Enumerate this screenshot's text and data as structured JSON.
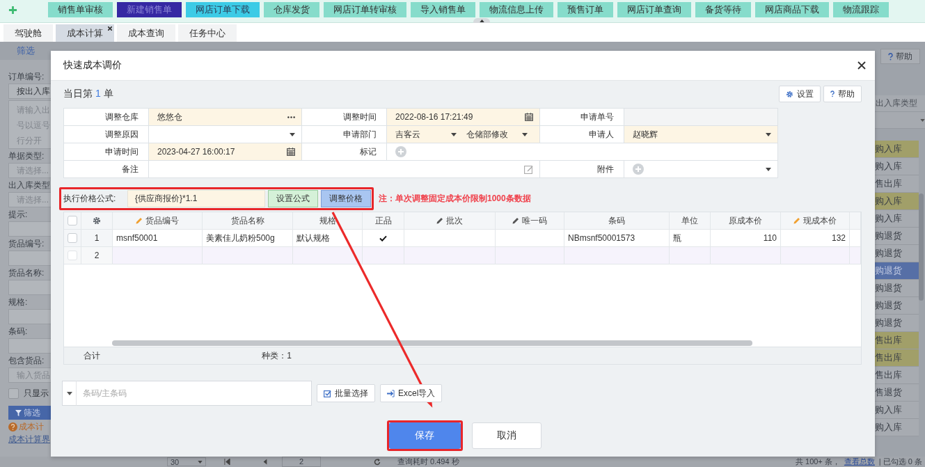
{
  "top_nav": {
    "items": [
      {
        "label": "销售单审核",
        "selected": false,
        "hovered": false
      },
      {
        "label": "新建销售单",
        "selected": true,
        "hovered": false
      },
      {
        "label": "网店订单下载",
        "selected": false,
        "hovered": true
      },
      {
        "label": "仓库发货",
        "selected": false,
        "hovered": false
      },
      {
        "label": "网店订单转审核",
        "selected": false,
        "hovered": false
      },
      {
        "label": "导入销售单",
        "selected": false,
        "hovered": false
      },
      {
        "label": "物流信息上传",
        "selected": false,
        "hovered": false
      },
      {
        "label": "预售订单",
        "selected": false,
        "hovered": false
      },
      {
        "label": "网店订单查询",
        "selected": false,
        "hovered": false
      },
      {
        "label": "备货等待",
        "selected": false,
        "hovered": false
      },
      {
        "label": "网店商品下载",
        "selected": false,
        "hovered": false
      },
      {
        "label": "物流跟踪",
        "selected": false,
        "hovered": false
      }
    ]
  },
  "tabs": [
    {
      "label": "驾驶舱",
      "selected": false,
      "closable": false
    },
    {
      "label": "成本计算",
      "selected": true,
      "closable": true
    },
    {
      "label": "成本查询",
      "selected": false,
      "closable": false
    },
    {
      "label": "任务中心",
      "selected": false,
      "closable": false
    }
  ],
  "filter_panel": {
    "title": "筛选",
    "fields": [
      {
        "label": "订单编号:",
        "kind": "select",
        "value": "按出入库"
      },
      {
        "kind": "textarea",
        "placeholder_lines": [
          "请输入出",
          "号以逗号",
          "行分开"
        ]
      },
      {
        "label": "单据类型:",
        "kind": "select",
        "placeholder": "请选择..."
      },
      {
        "label": "出入库类型",
        "kind": "select",
        "placeholder": "请选择..."
      },
      {
        "label": "提示:",
        "kind": "input"
      },
      {
        "label": "货品编号:",
        "kind": "input"
      },
      {
        "label": "货品名称:",
        "kind": "input"
      },
      {
        "label": "规格:",
        "kind": "input"
      },
      {
        "label": "条码:",
        "kind": "input"
      },
      {
        "label": "包含货品:",
        "kind": "input",
        "placeholder": "输入货品"
      }
    ],
    "checkbox": {
      "label": "只显示",
      "checked": false
    },
    "filter_button": "筛选",
    "tip": "成本计",
    "link": "成本计算界"
  },
  "side_column": {
    "help_button": "帮助",
    "header": "出入库类型",
    "rows": [
      {
        "text": "购入库",
        "highlighted": true,
        "selected": false
      },
      {
        "text": "购入库",
        "highlighted": false,
        "selected": false
      },
      {
        "text": "售出库",
        "highlighted": false,
        "selected": false
      },
      {
        "text": "购入库",
        "highlighted": true,
        "selected": false
      },
      {
        "text": "购入库",
        "highlighted": false,
        "selected": false
      },
      {
        "text": "购退货",
        "highlighted": false,
        "selected": false
      },
      {
        "text": "购退货",
        "highlighted": false,
        "selected": false
      },
      {
        "text": "购退货",
        "highlighted": false,
        "selected": true
      },
      {
        "text": "购退货",
        "highlighted": false,
        "selected": false
      },
      {
        "text": "购退货",
        "highlighted": false,
        "selected": false
      },
      {
        "text": "购退货",
        "highlighted": false,
        "selected": false
      },
      {
        "text": "售出库",
        "highlighted": true,
        "selected": false
      },
      {
        "text": "售出库",
        "highlighted": true,
        "selected": false
      },
      {
        "text": "售出库",
        "highlighted": false,
        "selected": false
      },
      {
        "text": "售退货",
        "highlighted": false,
        "selected": false
      },
      {
        "text": "购入库",
        "highlighted": false,
        "selected": false
      },
      {
        "text": "购入库",
        "highlighted": false,
        "selected": false
      }
    ]
  },
  "pagination": {
    "page_size": "30",
    "page": "2",
    "query_time": "查询耗时 0.494 秒",
    "total": "共 100+ 条，",
    "view_total": "查看总数",
    "checked": "| 已勾选 0 条"
  },
  "modal": {
    "title": "快速成本调价",
    "counter": {
      "prefix": "当日第",
      "count": "1",
      "suffix": "单"
    },
    "buttons": [
      {
        "kind": "settings",
        "label": "设置"
      },
      {
        "kind": "help",
        "label": "帮助"
      }
    ],
    "form": {
      "rows": [
        [
          {
            "label": "调整仓库",
            "kind": "picker",
            "value": "悠悠仓",
            "required": true,
            "disabled": false
          },
          {
            "label": "调整时间",
            "kind": "date",
            "value": "2022-08-16 17:21:49",
            "required": true,
            "disabled": false
          },
          {
            "label": "申请单号",
            "kind": "text",
            "required": false,
            "disabled": true
          }
        ],
        [
          {
            "label": "调整原因",
            "kind": "select",
            "required": false,
            "disabled": false
          },
          {
            "label": "申请部门",
            "kind": "dual-select",
            "values": [
              "吉客云",
              "仓储部修改"
            ],
            "required": true,
            "disabled": false
          },
          {
            "label": "申请人",
            "kind": "select",
            "value": "赵晓辉",
            "required": true,
            "disabled": false
          }
        ],
        [
          {
            "label": "申请时间",
            "kind": "date",
            "value": "2023-04-27 16:00:17",
            "required": true,
            "disabled": false
          },
          {
            "label": "标记",
            "kind": "mark",
            "required": false,
            "disabled": false
          }
        ],
        [
          {
            "label": "备注",
            "kind": "note",
            "required": false,
            "disabled": false
          },
          null,
          {
            "label": "附件",
            "kind": "attachment",
            "required": false,
            "disabled": false
          }
        ]
      ]
    },
    "formula": {
      "label": "执行价格公式:",
      "value": "{供应商报价}*1.1",
      "buttons": [
        {
          "kind": "set",
          "label": "设置公式"
        },
        {
          "kind": "adjust",
          "label": "调整价格"
        }
      ],
      "note": "注：单次调整固定成本价限制1000条数据"
    },
    "grid": {
      "all_checked": false,
      "columns": [
        {
          "label": "货品编号",
          "kind": "text",
          "color": "#f0a030"
        },
        {
          "label": "货品名称",
          "kind": "text"
        },
        {
          "label": "规格",
          "kind": "text"
        },
        {
          "label": "正品",
          "kind": "check"
        },
        {
          "label": "批次",
          "kind": "text",
          "color": "#555555"
        },
        {
          "label": "唯一码",
          "kind": "text",
          "color": "#555555"
        },
        {
          "label": "条码",
          "kind": "text"
        },
        {
          "label": "单位",
          "kind": "text"
        },
        {
          "label": "原成本价",
          "kind": "number"
        },
        {
          "label": "现成本价",
          "kind": "number",
          "color": "#f0a030"
        }
      ],
      "rows": [
        {
          "number": "1",
          "kind": "item",
          "checked": false,
          "cells": [
            "msnf50001",
            "美素佳儿奶粉500g",
            "默认规格",
            true,
            null,
            null,
            "NBmsnf50001573",
            "瓶",
            "110",
            "132"
          ]
        },
        {
          "number": "2",
          "kind": "blank",
          "checked": false
        }
      ],
      "footer": {
        "label": "合计",
        "kinds": "种类：1"
      }
    },
    "scan": {
      "placeholder": "条码/主条码",
      "buttons": [
        {
          "kind": "batch",
          "label": "批量选择"
        },
        {
          "kind": "import",
          "label": "Excel导入"
        }
      ]
    },
    "actions": [
      {
        "kind": "primary",
        "label": "保存",
        "highlighted": true
      },
      {
        "kind": "secondary",
        "label": "取消",
        "highlighted": false
      }
    ]
  }
}
